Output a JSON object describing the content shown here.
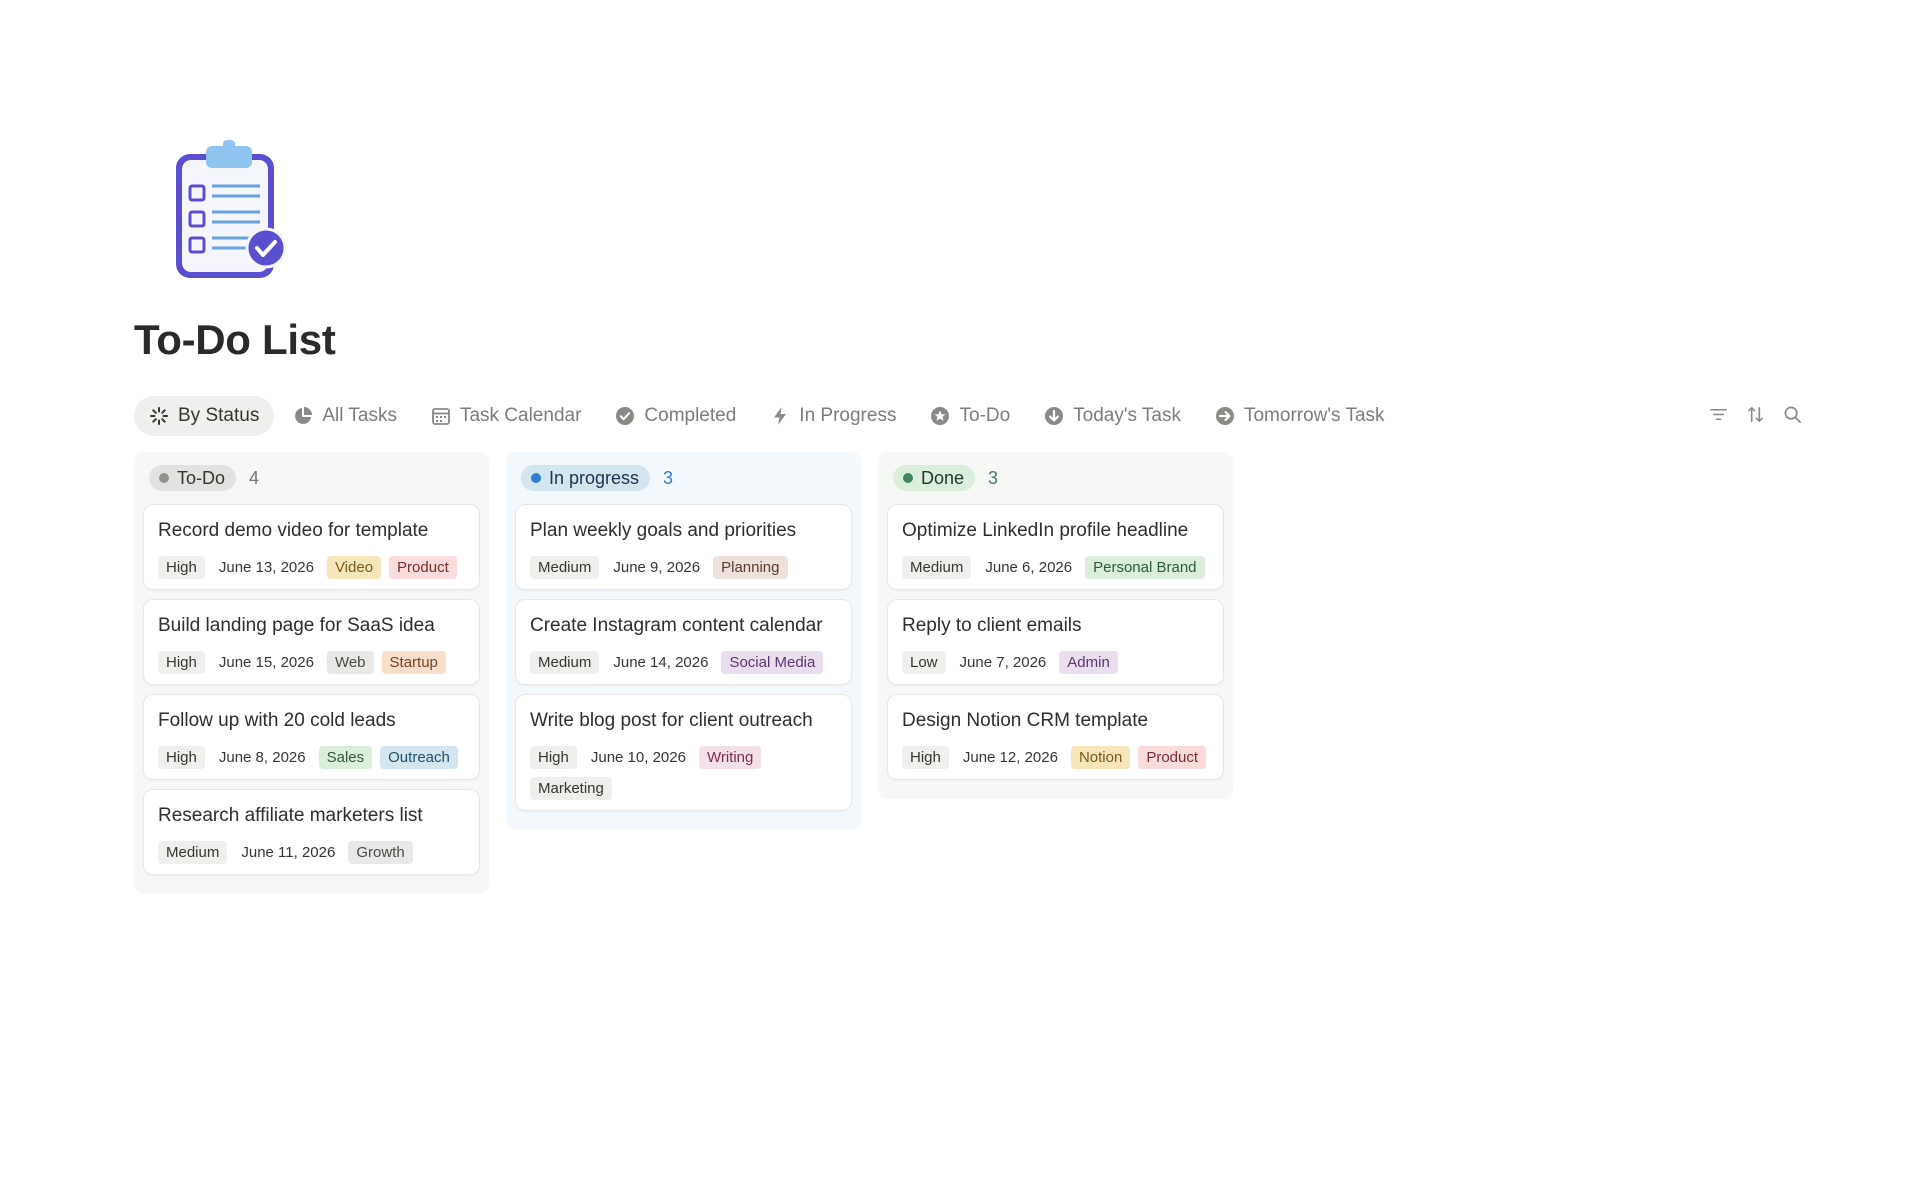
{
  "page": {
    "title": "To-Do List",
    "icon": "clipboard-checklist-icon"
  },
  "tabs": [
    {
      "label": "By Status",
      "icon": "loading-spinner-icon",
      "active": true
    },
    {
      "label": "All Tasks",
      "icon": "pie-chart-icon"
    },
    {
      "label": "Task Calendar",
      "icon": "calendar-icon"
    },
    {
      "label": "Completed",
      "icon": "check-circle-icon"
    },
    {
      "label": "In Progress",
      "icon": "lightning-bolt-icon"
    },
    {
      "label": "To-Do",
      "icon": "star-circle-icon"
    },
    {
      "label": "Today's Task",
      "icon": "arrow-down-circle-icon"
    },
    {
      "label": "Tomorrow's Task",
      "icon": "arrow-right-circle-icon"
    }
  ],
  "tools": [
    "filter-icon",
    "sort-icon",
    "search-icon"
  ],
  "colors": {
    "todo_bg": "#f7f7f5",
    "todo_pill": "#e3e2e0",
    "todo_dot": "#91918e",
    "todo_text": "#37352f",
    "todo_count": "#787774",
    "inprogress_bg": "#f3f8fc",
    "inprogress_pill": "#d3e5ef",
    "inprogress_dot": "#2e7dd1",
    "inprogress_text": "#18344d",
    "inprogress_count": "#2e7dd1",
    "done_bg": "#f6f8f6",
    "done_pill": "#dbeddb",
    "done_dot": "#448361",
    "done_text": "#1c3829",
    "done_count": "#448361"
  },
  "columns": [
    {
      "name": "To-Do",
      "count": "4",
      "cards": [
        {
          "title": "Record demo video for template",
          "priority": "High",
          "date": "June 13, 2026",
          "tags": [
            "Video",
            "Product"
          ]
        },
        {
          "title": "Build landing page for SaaS idea",
          "priority": "High",
          "date": "June 15, 2026",
          "tags": [
            "Web",
            "Startup"
          ]
        },
        {
          "title": "Follow up with 20 cold leads",
          "priority": "High",
          "date": "June 8, 2026",
          "tags": [
            "Sales",
            "Outreach"
          ]
        },
        {
          "title": "Research affiliate marketers list",
          "priority": "Medium",
          "date": "June 11, 2026",
          "tags": [
            "Growth"
          ]
        }
      ]
    },
    {
      "name": "In progress",
      "count": "3",
      "cards": [
        {
          "title": "Plan weekly goals and priorities",
          "priority": "Medium",
          "date": "June 9, 2026",
          "tags": [
            "Planning"
          ]
        },
        {
          "title": "Create Instagram content calendar",
          "priority": "Medium",
          "date": "June 14, 2026",
          "tags": [
            "Social Media"
          ]
        },
        {
          "title": "Write blog post for client outreach",
          "priority": "High",
          "date": "June 10, 2026",
          "tags": [
            "Writing",
            "Marketing"
          ]
        }
      ]
    },
    {
      "name": "Done",
      "count": "3",
      "cards": [
        {
          "title": "Optimize LinkedIn profile headline",
          "priority": "Medium",
          "date": "June 6, 2026",
          "tags": [
            "Personal Brand"
          ]
        },
        {
          "title": "Reply to client emails",
          "priority": "Low",
          "date": "June 7, 2026",
          "tags": [
            "Admin"
          ]
        },
        {
          "title": "Design Notion CRM template",
          "priority": "High",
          "date": "June 12, 2026",
          "tags": [
            "Notion",
            "Product"
          ]
        }
      ]
    }
  ],
  "tag_colors": {
    "Video": {
      "bg": "#f6e6b9",
      "fg": "#7a5a1c"
    },
    "Product": {
      "bg": "#f9dcdb",
      "fg": "#7a2e2a"
    },
    "Web": {
      "bg": "#e9e8e6",
      "fg": "#4a4946"
    },
    "Startup": {
      "bg": "#f8dfcb",
      "fg": "#7a4522"
    },
    "Sales": {
      "bg": "#dbeddb",
      "fg": "#2b5b3b"
    },
    "Outreach": {
      "bg": "#d3e5ef",
      "fg": "#1f4f6e"
    },
    "Growth": {
      "bg": "#e9e8e6",
      "fg": "#4a4946"
    },
    "Planning": {
      "bg": "#eee0da",
      "fg": "#5a3b2d"
    },
    "Social Media": {
      "bg": "#e8deee",
      "fg": "#5a3675"
    },
    "Writing": {
      "bg": "#f5e0e9",
      "fg": "#7a2d52"
    },
    "Marketing": {
      "bg": "#efeeec",
      "fg": "#37352f"
    },
    "Personal Brand": {
      "bg": "#dbeddb",
      "fg": "#2b5b3b"
    },
    "Admin": {
      "bg": "#e8deee",
      "fg": "#5a3675"
    },
    "Notion": {
      "bg": "#f6e6b9",
      "fg": "#7a5a1c"
    }
  }
}
